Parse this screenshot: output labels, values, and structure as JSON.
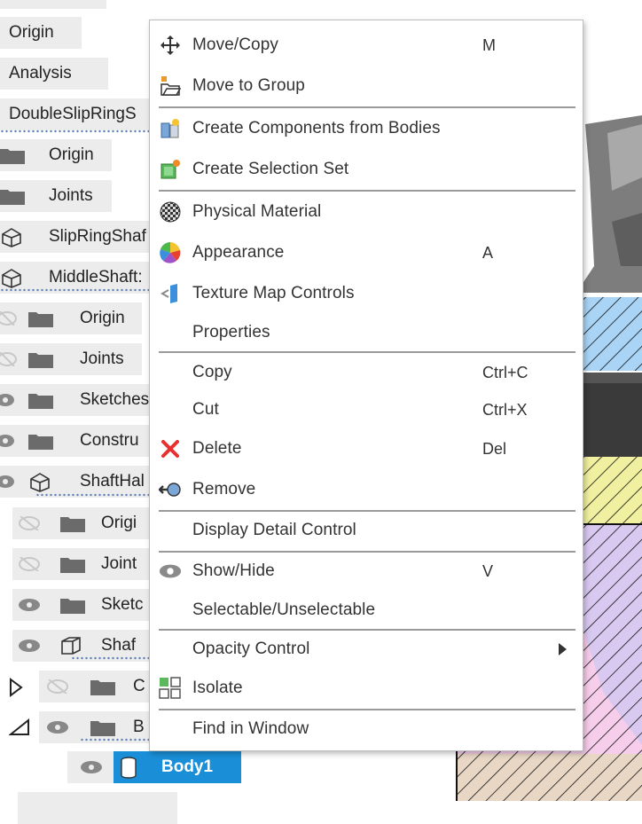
{
  "tree": {
    "items": [
      {
        "label": "Origin"
      },
      {
        "label": "Analysis"
      },
      {
        "label": "DoubleSlipRingS"
      },
      {
        "label": "Origin"
      },
      {
        "label": "Joints"
      },
      {
        "label": "SlipRingShaf"
      },
      {
        "label": "MiddleShaft:"
      },
      {
        "label": "Origin"
      },
      {
        "label": "Joints"
      },
      {
        "label": "Sketches"
      },
      {
        "label": "Constru"
      },
      {
        "label": "ShaftHal"
      },
      {
        "label": "Origi"
      },
      {
        "label": "Joint"
      },
      {
        "label": "Sketc"
      },
      {
        "label": "Shaf"
      },
      {
        "label": "C"
      },
      {
        "label": "B"
      },
      {
        "label": "Body1"
      }
    ]
  },
  "menu": {
    "items": [
      {
        "label": "Move/Copy",
        "shortcut": "M",
        "icon": "move-icon"
      },
      {
        "label": "Move to Group",
        "shortcut": "",
        "icon": "group-folder-icon"
      },
      {
        "label": "Create Components from Bodies",
        "shortcut": "",
        "icon": "create-components-icon"
      },
      {
        "label": "Create Selection Set",
        "shortcut": "",
        "icon": "selection-set-icon"
      },
      {
        "label": "Physical Material",
        "shortcut": "",
        "icon": "material-icon"
      },
      {
        "label": "Appearance",
        "shortcut": "A",
        "icon": "appearance-icon"
      },
      {
        "label": "Texture Map Controls",
        "shortcut": "",
        "icon": "texture-map-icon"
      },
      {
        "label": "Properties",
        "shortcut": "",
        "icon": ""
      },
      {
        "label": "Copy",
        "shortcut": "Ctrl+C",
        "icon": ""
      },
      {
        "label": "Cut",
        "shortcut": "Ctrl+X",
        "icon": ""
      },
      {
        "label": "Delete",
        "shortcut": "Del",
        "icon": "delete-icon"
      },
      {
        "label": "Remove",
        "shortcut": "",
        "icon": "remove-icon"
      },
      {
        "label": "Display Detail Control",
        "shortcut": "",
        "icon": ""
      },
      {
        "label": "Show/Hide",
        "shortcut": "V",
        "icon": "eye-icon"
      },
      {
        "label": "Selectable/Unselectable",
        "shortcut": "",
        "icon": ""
      },
      {
        "label": "Opacity Control",
        "shortcut": "",
        "icon": "submenu-arrow-icon"
      },
      {
        "label": "Isolate",
        "shortcut": "",
        "icon": "isolate-icon"
      },
      {
        "label": "Find in Window",
        "shortcut": "",
        "icon": ""
      }
    ]
  },
  "colors": {
    "selection": "#1a8fd8",
    "tree_bg": "#ececec",
    "delete_red": "#e8312f",
    "hatch_blue": "#a9d4f5",
    "hatch_yellow": "#f0f0a0",
    "hatch_pink": "#f6cdea",
    "hatch_purple": "#d9c8f0"
  }
}
